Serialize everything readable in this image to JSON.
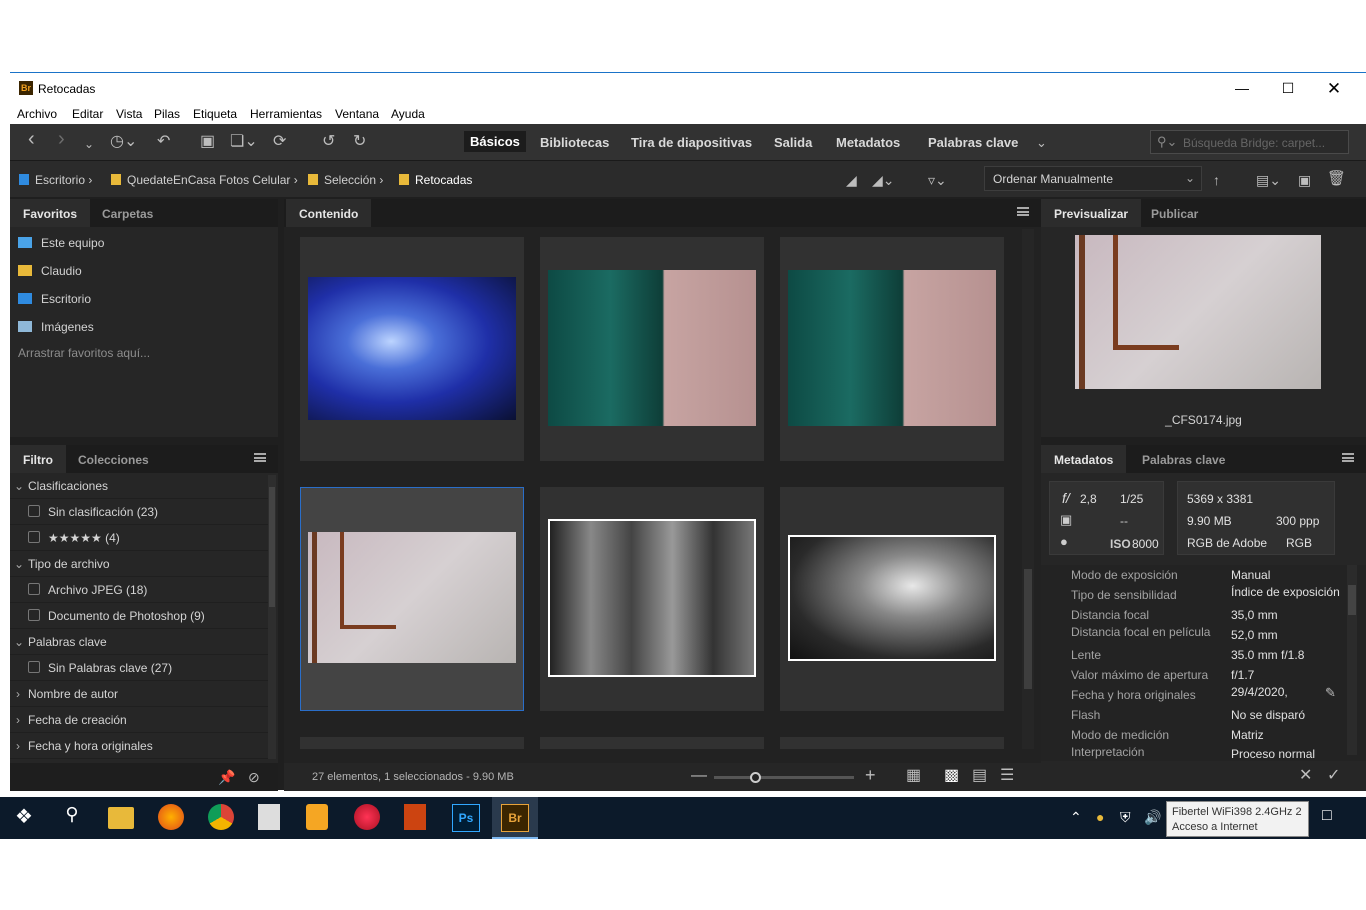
{
  "window": {
    "title": "Retocadas",
    "app_icon": "Br"
  },
  "menu": [
    "Archivo",
    "Editar",
    "Vista",
    "Pilas",
    "Etiqueta",
    "Herramientas",
    "Ventana",
    "Ayuda"
  ],
  "workspaces": [
    "Básicos",
    "Bibliotecas",
    "Tira de diapositivas",
    "Salida",
    "Metadatos",
    "Palabras clave"
  ],
  "search": {
    "placeholder": "Búsqueda Bridge: carpet..."
  },
  "breadcrumb": [
    "Escritorio",
    "QuedateEnCasa Fotos Celular",
    "Selección",
    "Retocadas"
  ],
  "sort": {
    "label": "Ordenar Manualmente"
  },
  "favorites_panel": {
    "tabs": [
      "Favoritos",
      "Carpetas"
    ],
    "items": [
      "Este equipo",
      "Claudio",
      "Escritorio",
      "Imágenes"
    ],
    "hint": "Arrastrar favoritos aquí..."
  },
  "filter_panel": {
    "tabs": [
      "Filtro",
      "Colecciones"
    ],
    "rows": [
      {
        "type": "group",
        "label": "Clasificaciones"
      },
      {
        "type": "item",
        "label": "Sin clasificación (23)"
      },
      {
        "type": "item",
        "label": "★★★★★ (4)"
      },
      {
        "type": "group",
        "label": "Tipo de archivo"
      },
      {
        "type": "item",
        "label": "Archivo JPEG (18)"
      },
      {
        "type": "item",
        "label": "Documento de Photoshop (9)"
      },
      {
        "type": "group",
        "label": "Palabras clave"
      },
      {
        "type": "item",
        "label": "Sin Palabras clave (27)"
      },
      {
        "type": "collapsed",
        "label": "Nombre de autor"
      },
      {
        "type": "collapsed",
        "label": "Fecha de creación"
      },
      {
        "type": "collapsed",
        "label": "Fecha y hora originales"
      }
    ]
  },
  "content_panel": {
    "tab": "Contenido",
    "status": "27 elementos, 1 seleccionados - 9.90 MB"
  },
  "preview_panel": {
    "tabs": [
      "Previsualizar",
      "Publicar"
    ],
    "filename": "_CFS0174.jpg"
  },
  "metadata_panel": {
    "tabs": [
      "Metadatos",
      "Palabras clave"
    ],
    "summary": {
      "aperture": "2,8",
      "shutter": "1/25",
      "dash": "--",
      "iso_label": "ISO",
      "iso": "8000",
      "dimensions": "5369 x 3381",
      "size": "9.90 MB",
      "ppi": "300 ppp",
      "profile": "RGB de Adobe",
      "mode": "RGB"
    },
    "fields": [
      {
        "k": "Modo de exposición",
        "v": "Manual"
      },
      {
        "k": "Tipo de sensibilidad",
        "v": "Índice de exposición"
      },
      {
        "k": "Distancia focal",
        "v": "35,0 mm"
      },
      {
        "k": "Distancia focal en película",
        "v": "52,0 mm"
      },
      {
        "k": "Lente",
        "v": "35.0 mm f/1.8"
      },
      {
        "k": "Valor máximo de apertura",
        "v": "f/1.7"
      },
      {
        "k": "Fecha y hora originales",
        "v": "29/4/2020,"
      },
      {
        "k": "Flash",
        "v": "No se disparó"
      },
      {
        "k": "Modo de medición",
        "v": "Matriz"
      },
      {
        "k": "Interpretación",
        "v": "Proceso normal"
      }
    ]
  },
  "taskbar": {
    "tooltip_line1": "Fibertel WiFi398 2.4GHz 2",
    "tooltip_line2": "Acceso a Internet",
    "ps": "Ps",
    "br": "Br"
  },
  "colors": {
    "accent": "#2a6ec9",
    "bg_dark": "#1f1f1f",
    "panel": "#262626",
    "taskbar": "#0c1a2a"
  }
}
